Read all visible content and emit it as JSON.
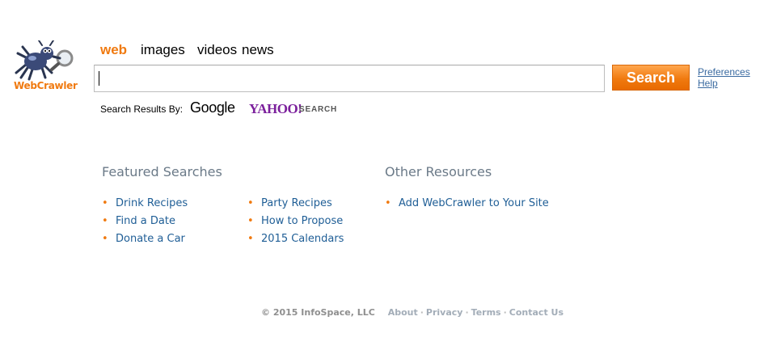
{
  "logo": {
    "text": "WebCrawler",
    "icon": "spider-magnifier-logo"
  },
  "nav": {
    "tabs": [
      "web",
      "images",
      "videos",
      "news"
    ],
    "active": "web"
  },
  "search": {
    "value": "",
    "placeholder": "",
    "button_label": "Search"
  },
  "right_links": {
    "preferences": "Preferences",
    "help": "Help"
  },
  "results_by": {
    "label": "Search Results By:",
    "google": "Google",
    "yahoo": "YAHOO!",
    "yahoo_suffix": "SEARCH"
  },
  "featured": {
    "title": "Featured Searches",
    "column1": [
      "Drink Recipes",
      "Find a Date",
      "Donate a Car"
    ],
    "column2": [
      "Party Recipes",
      "How to Propose",
      "2015 Calendars"
    ]
  },
  "other": {
    "title": "Other Resources",
    "items": [
      "Add WebCrawler to Your Site"
    ]
  },
  "footer": {
    "copyright": "© 2015 InfoSpace, LLC",
    "links": [
      "About",
      "Privacy",
      "Terms",
      "Contact Us"
    ],
    "separator": "·"
  },
  "colors": {
    "accent": "#f07a10",
    "link": "#1f5e96",
    "yahoo": "#7b1f9c",
    "heading": "#6b7a88"
  }
}
